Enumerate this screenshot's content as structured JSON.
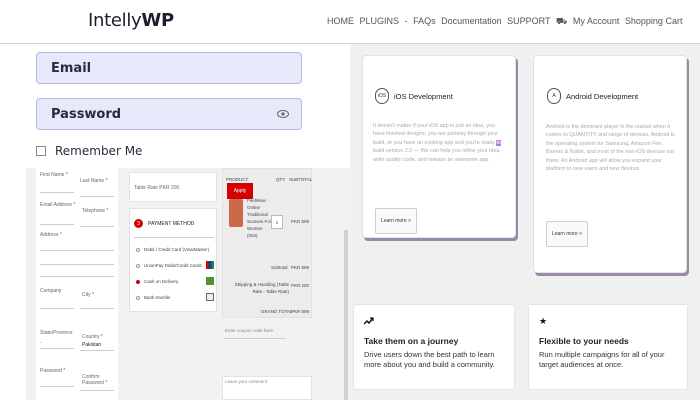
{
  "header": {
    "logo_text": "Intelly",
    "logo_bold": "WP",
    "nav": [
      "HOME",
      "PLUGINS",
      "-",
      "FAQs",
      "Documentation",
      "SUPPORT",
      "⛟",
      "My Account",
      "Shopping Cart"
    ]
  },
  "login": {
    "email_placeholder": "Email",
    "password_placeholder": "Password",
    "remember_label": "Remember Me"
  },
  "checkout": {
    "fields": [
      "First Name *",
      "Last Name *",
      "Email Address *",
      "Telephone *",
      "Address *",
      "Company",
      "City *",
      "State/Province",
      "-",
      "Country *",
      "Pakistan",
      "Password *",
      "Confirm Password *"
    ],
    "table_rate": "Table Rate PKR 200",
    "payment_step": "3",
    "payment_title": "PAYMENT METHOD",
    "payment_options": [
      "Debit / Credit Card (Visa/Master)",
      "UnionPay Debit/Credit Cards",
      "Cash on Delivery",
      "Bank transfer"
    ],
    "order_headers": [
      "PRODUCT",
      "QTY",
      "SUBTOTAL"
    ],
    "product_name": [
      "FeelWow",
      "Online",
      "Traditional",
      "Scarves For",
      "Women",
      "(004)"
    ],
    "qty": "1",
    "price": "PKR 699",
    "subtotal_label": "Subtotal",
    "subtotal_value": "PKR 699",
    "shipping_label": "Shipping & Handling (Table Rate - Table Rate)",
    "shipping_value": "PKR 200",
    "grand_total_label": "GRAND TOTAL",
    "grand_total_value": "PKR 899",
    "coupon_placeholder": "Enter coupon code here",
    "apply_label": "Apply",
    "comment_placeholder": "Leave your comment"
  },
  "cards": [
    {
      "title": "iOS Development",
      "icon_text": "iOS",
      "body_before": "It doesn't matter if your iOS app is just an idea, you have finished designs, you are partway through your build, or you have an existing app and you're ready",
      "highlight": "to",
      "body_after": "build version 2.0 — We can help you refine your idea, write quality code, and release an awesome app.",
      "button": "Learn more >"
    },
    {
      "title": "Android Development",
      "icon_text": "A",
      "body_before": "Android is the dominant player in the market when it comes to QUANTITY and range of devices. Android is the operating system for Samsung, Amazon Fire, Barnes & Noble, and most of the non-iOS devices out there. An Android app will allow you expand your platform to new users and new devices.",
      "highlight": "",
      "body_after": "",
      "button": "Learn more >"
    }
  ],
  "features": [
    {
      "icon": "trend-icon",
      "title": "Take them on a journey",
      "body": "Drive users down the best path to learn more about you and build a community."
    },
    {
      "icon": "star-icon",
      "title": "Flexible to your needs",
      "body": "Run multiple campaigns for all of your target audiences at once."
    }
  ],
  "colors": {
    "field_bg": "#e8e8fb",
    "apply_red": "#d40000",
    "highlight_purple": "#b57dd3",
    "card_shadow": "#9a8aa4"
  }
}
